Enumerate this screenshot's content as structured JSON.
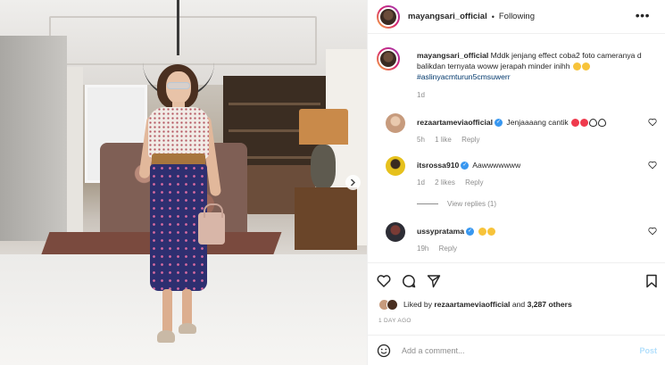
{
  "header": {
    "username": "mayangsari_official",
    "separator": "•",
    "follow_status": "Following",
    "more_icon": "more-horizontal-icon"
  },
  "caption": {
    "username": "mayangsari_official",
    "text": "Mddk jenjang effect coba2 foto cameranya d balikdan ternyata woww jerapah minder inihh",
    "hashtag": "#aslinyacmturun5cmsuwerr",
    "time": "1d"
  },
  "comments": [
    {
      "username": "rezaartameviaofficial",
      "verified": true,
      "text": "Jenjaaaang cantik",
      "time": "5h",
      "likes": "1 like",
      "reply": "Reply"
    },
    {
      "username": "itsrossa910",
      "verified": true,
      "text": "Aawwwwwww",
      "time": "1d",
      "likes": "2 likes",
      "reply": "Reply",
      "view_replies": "View replies (1)"
    },
    {
      "username": "ussypratama",
      "verified": true,
      "text": "",
      "time": "19h",
      "reply": "Reply"
    }
  ],
  "likes": {
    "prefix": "Liked by",
    "user": "rezaartameviaofficial",
    "joiner": "and",
    "count": "3,287 others"
  },
  "date": "1 DAY AGO",
  "comment_box": {
    "placeholder": "Add a comment...",
    "post_label": "Post"
  },
  "colors": {
    "link_blue": "#00376b",
    "verified_blue": "#3897f0",
    "post_disabled": "#b2dffc",
    "muted": "#8e8e8e"
  }
}
